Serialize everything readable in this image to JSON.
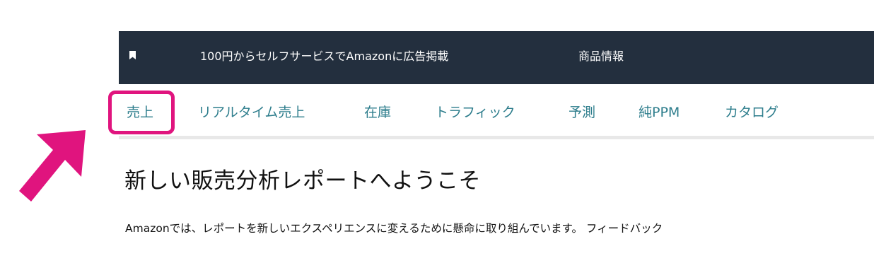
{
  "topbar": {
    "links": [
      "100円からセルフサービスでAmazonに広告掲載",
      "商品情報"
    ]
  },
  "subnav": {
    "items": [
      "売上",
      "リアルタイム売上",
      "在庫",
      "トラフィック",
      "予測",
      "純PPM",
      "カタログ"
    ],
    "highlighted": "売上"
  },
  "welcome": {
    "title": "新しい販売分析レポートへようこそ",
    "body": "Amazonでは、レポートを新しいエクスペリエンスに変えるために懸命に取り組んでいます。 フィードバック"
  },
  "annotation": {
    "color": "#e0147e",
    "icons": [
      "arrow-icon"
    ]
  }
}
